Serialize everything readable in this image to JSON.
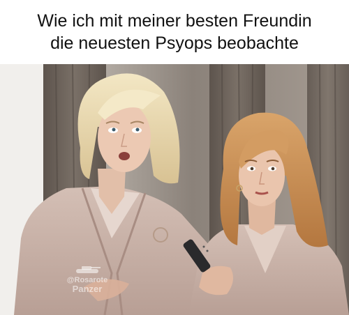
{
  "caption": {
    "line1": "Wie ich mit meiner besten Freundin",
    "line2": "die neuesten Psyops beobachte"
  },
  "watermark": {
    "handle": "@Rosarote",
    "name": "Panzer",
    "icon": "tank-icon"
  },
  "scene": {
    "subjects": [
      "woman-left",
      "woman-right"
    ],
    "held_object": "tv-remote"
  },
  "colors": {
    "caption_bg": "#ffffff",
    "caption_text": "#111111",
    "robe": "#c9b2a8",
    "hair_left": "#e9d9b0",
    "hair_right": "#c98c52",
    "curtain": "#6e645c"
  }
}
